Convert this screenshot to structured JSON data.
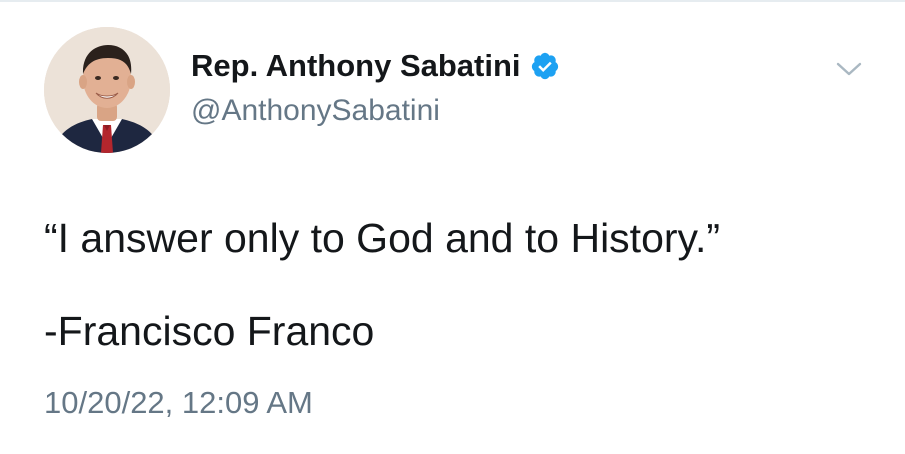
{
  "tweet": {
    "author": {
      "display_name": "Rep. Anthony Sabatini",
      "handle": "@AnthonySabatini",
      "verified": true,
      "avatar_icon": "profile-photo",
      "verified_icon": "verified-badge-icon"
    },
    "text_lines": [
      "“I answer only to God and to History.”",
      "-Francisco Franco"
    ],
    "timestamp": "10/20/22, 12:09 AM",
    "menu_icon": "chevron-down-icon"
  },
  "colors": {
    "text_primary": "#14171a",
    "text_secondary": "#657786",
    "verified_blue": "#1da1f2",
    "divider": "#e6ecf0",
    "caret": "#aab8c2"
  }
}
